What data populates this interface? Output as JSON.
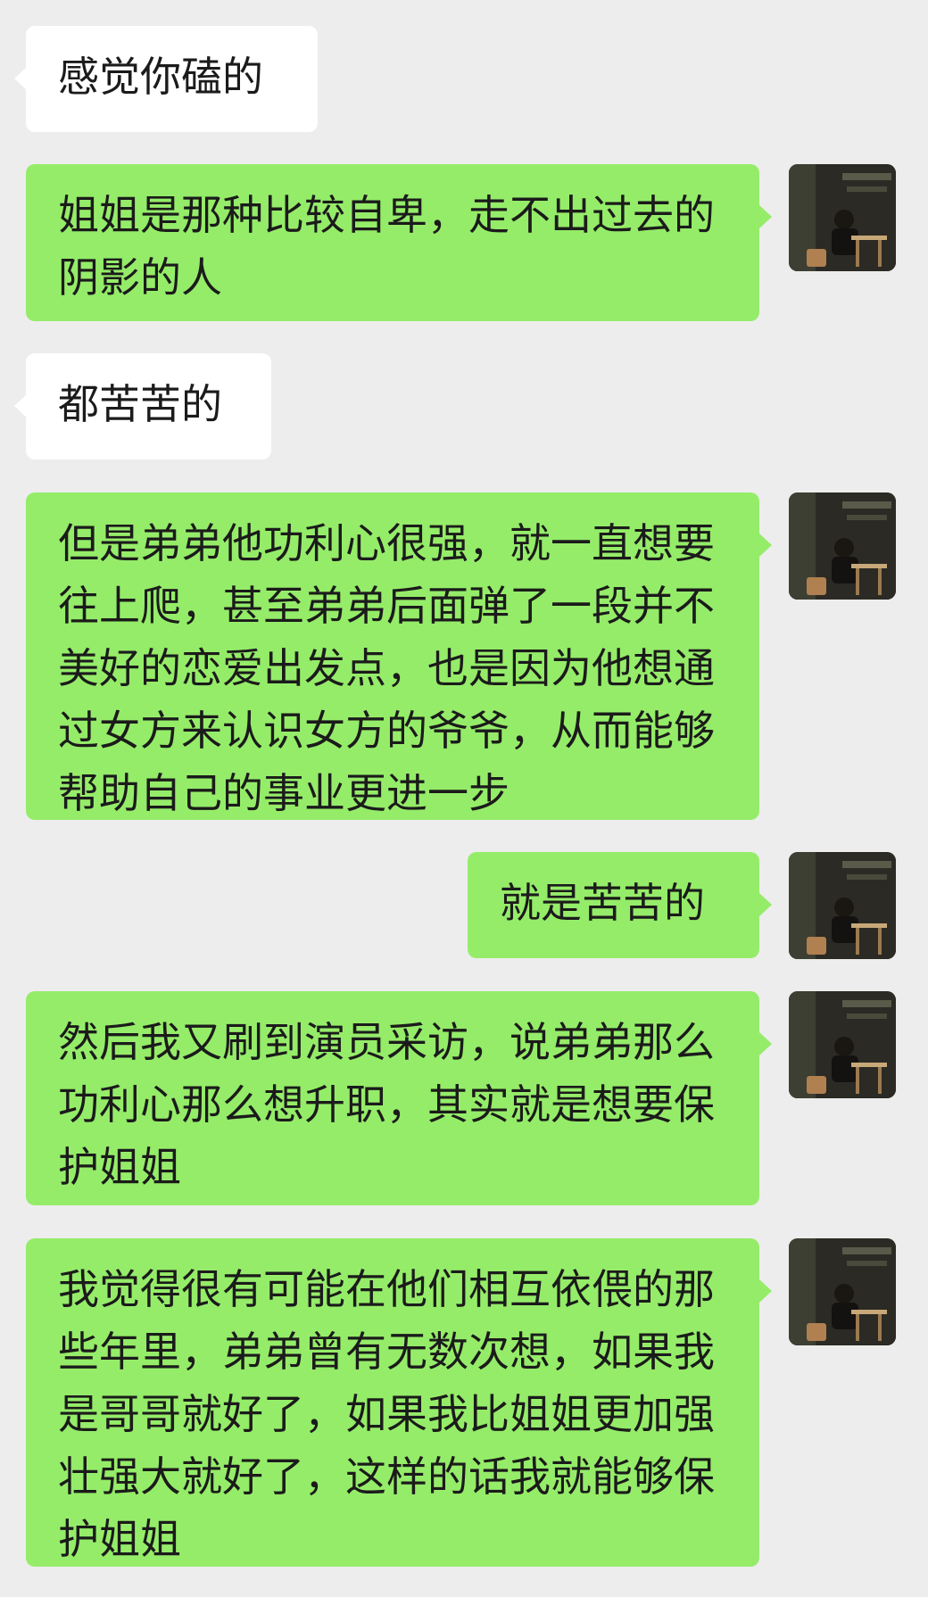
{
  "messages": [
    {
      "side": "in",
      "text": "感觉你磕的"
    },
    {
      "side": "out",
      "text": "姐姐是那种比较自卑，走不出过去的阴影的人",
      "avatar": "user-avatar"
    },
    {
      "side": "in",
      "text": "都苦苦的"
    },
    {
      "side": "out",
      "text": "但是弟弟他功利心很强，就一直想要往上爬，甚至弟弟后面弹了一段并不美好的恋爱出发点，也是因为他想通过女方来认识女方的爷爷，从而能够帮助自己的事业更进一步",
      "avatar": "user-avatar"
    },
    {
      "side": "out",
      "text": "就是苦苦的",
      "avatar": "user-avatar"
    },
    {
      "side": "out",
      "text": "然后我又刷到演员采访，说弟弟那么功利心那么想升职，其实就是想要保护姐姐",
      "avatar": "user-avatar"
    },
    {
      "side": "out",
      "text": "我觉得很有可能在他们相互依偎的那些年里，弟弟曾有无数次想，如果我是哥哥就好了，如果我比姐姐更加强壮强大就好了，这样的话我就能够保护姐姐",
      "avatar": "user-avatar"
    }
  ],
  "colors": {
    "background": "#ededed",
    "incoming_bubble": "#ffffff",
    "outgoing_bubble": "#95ec69",
    "text": "#1b1b1b"
  }
}
